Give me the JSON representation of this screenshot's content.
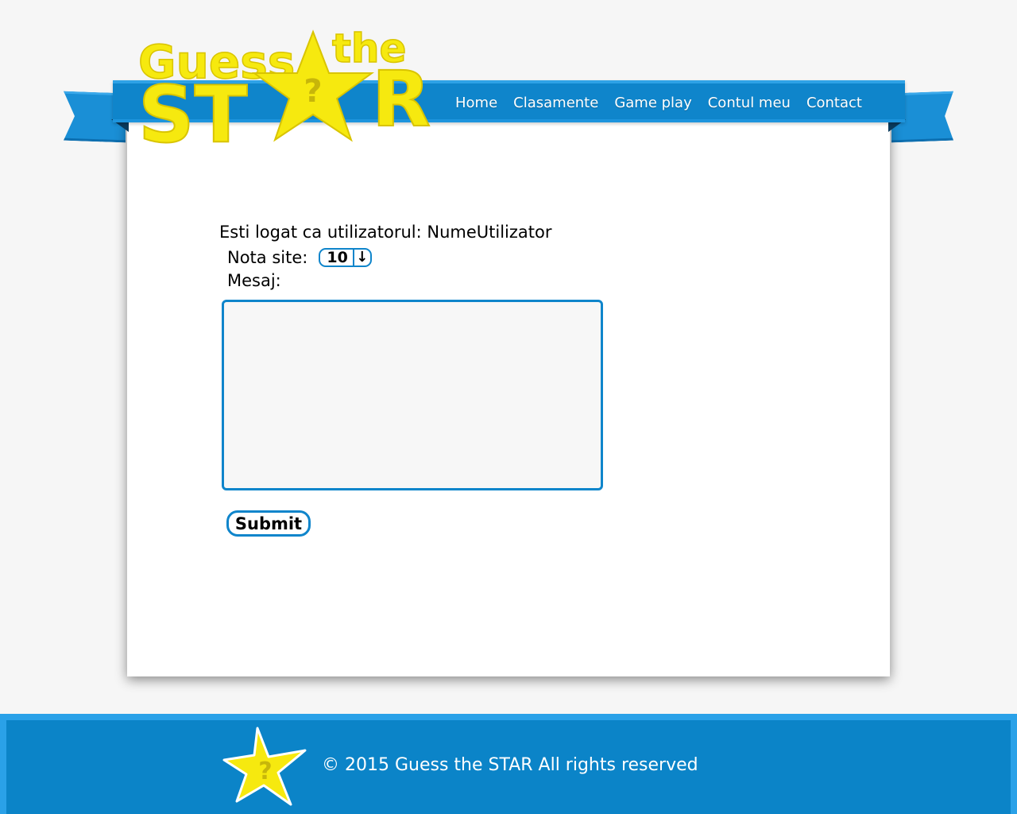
{
  "brand": {
    "logo_word_1": "Guess",
    "logo_word_2": "the",
    "logo_word_3": "ST",
    "logo_word_4": "R",
    "logo_star_mark": "?",
    "brand_yellow": "#f6e90f",
    "brand_blue": "#0f85cb"
  },
  "nav": {
    "items": [
      {
        "label": "Home"
      },
      {
        "label": "Clasamente"
      },
      {
        "label": "Game play"
      },
      {
        "label": "Contul meu"
      },
      {
        "label": "Contact"
      }
    ]
  },
  "form": {
    "logged_in_text": "Esti logat ca utilizatorul: NumeUtilizator",
    "rating_label": "Nota site:",
    "rating_value": "10",
    "rating_arrow": "↓",
    "message_label": "Mesaj:",
    "message_value": "",
    "submit_label": "Submit"
  },
  "footer": {
    "star_mark": "?",
    "copyright": "© 2015 Guess the STAR All rights reserved"
  }
}
